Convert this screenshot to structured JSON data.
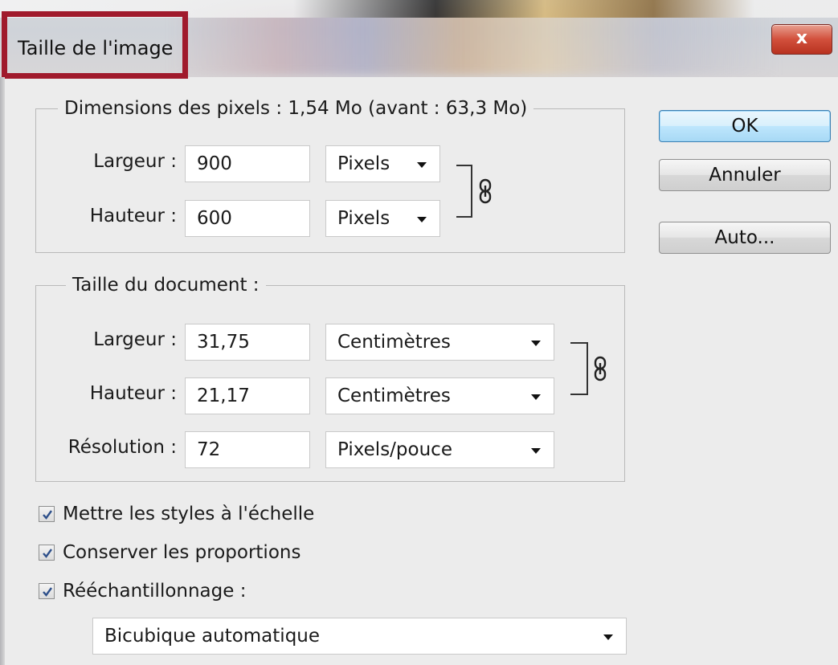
{
  "window": {
    "title": "Taille de l'image",
    "close_glyph": "x"
  },
  "pixel_dimensions": {
    "legend": "Dimensions des pixels : 1,54 Mo (avant : 63,3 Mo)",
    "width_label": "Largeur :",
    "width_value": "900",
    "width_unit": "Pixels",
    "height_label": "Hauteur :",
    "height_value": "600",
    "height_unit": "Pixels"
  },
  "document_size": {
    "legend": "Taille du document :",
    "width_label": "Largeur :",
    "width_value": "31,75",
    "width_unit": "Centimètres",
    "height_label": "Hauteur :",
    "height_value": "21,17",
    "height_unit": "Centimètres",
    "resolution_label": "Résolution :",
    "resolution_value": "72",
    "resolution_unit": "Pixels/pouce"
  },
  "buttons": {
    "ok": "OK",
    "cancel": "Annuler",
    "auto": "Auto..."
  },
  "options": {
    "scale_styles": {
      "label": "Mettre les styles à l'échelle",
      "checked": true
    },
    "constrain": {
      "label": "Conserver les proportions",
      "checked": true
    },
    "resample": {
      "label": "Rééchantillonnage :",
      "checked": true
    },
    "resample_method": "Bicubique automatique"
  },
  "icons": {
    "link": "chain-link-icon",
    "close": "close-icon",
    "check": "checkmark-icon",
    "dropdown": "chevron-down-icon"
  },
  "colors": {
    "highlight_border": "#a01a2c",
    "default_button_border": "#3c7fb1",
    "close_button": "#d2503c"
  }
}
